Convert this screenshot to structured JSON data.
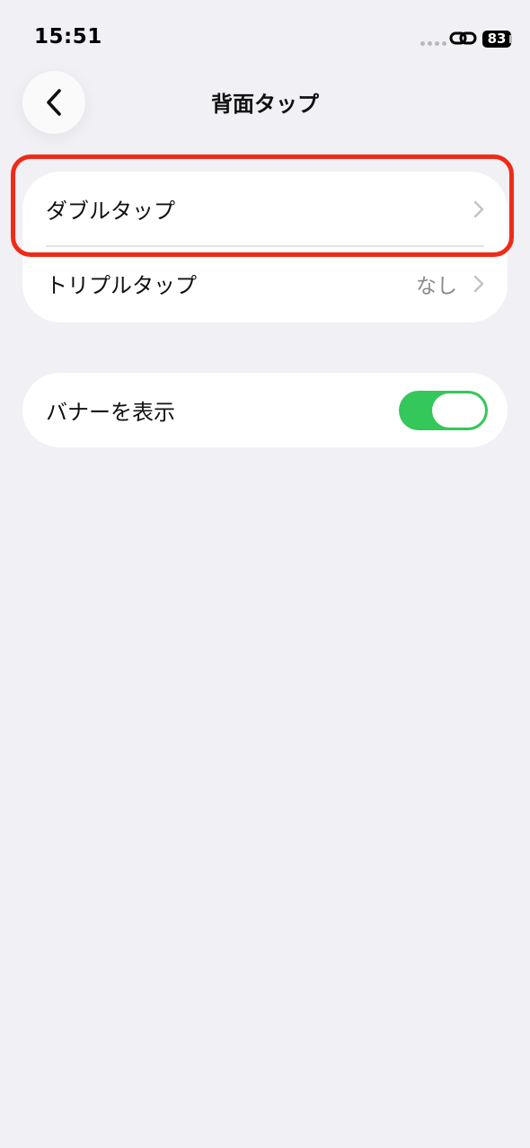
{
  "status_bar": {
    "time": "15:51",
    "battery": "83"
  },
  "nav": {
    "title": "背面タップ",
    "back_icon": "chevron-left-icon"
  },
  "groups": [
    {
      "rows": [
        {
          "label": "ダブルタップ",
          "value": "",
          "icon": "chevron-right-icon"
        },
        {
          "label": "トリプルタップ",
          "value": "なし",
          "icon": "chevron-right-icon"
        }
      ]
    },
    {
      "rows": [
        {
          "label": "バナーを表示",
          "toggle_on": true
        }
      ]
    }
  ],
  "colors": {
    "background": "#f0f0f5",
    "toggle_on": "#34c759",
    "highlight": "#f02a17"
  }
}
